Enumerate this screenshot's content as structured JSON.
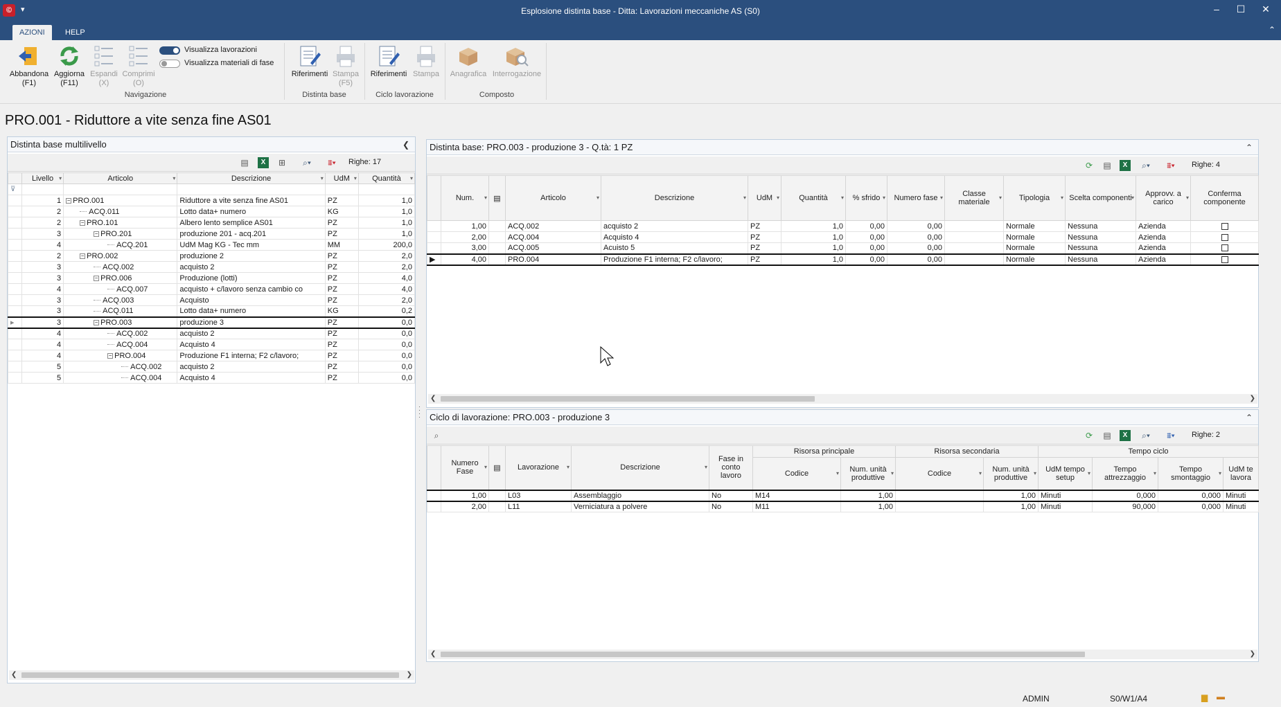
{
  "window": {
    "title": "Esplosione distinta base - Ditta: Lavorazioni meccaniche AS (S0)"
  },
  "tabs": [
    "AZIONI",
    "HELP"
  ],
  "ribbon": {
    "abbandona": "Abbandona",
    "abbandona_key": "(F1)",
    "aggiorna": "Aggiorna",
    "aggiorna_key": "(F11)",
    "espandi": "Espandi",
    "espandi_key": "(X)",
    "comprimi": "Comprimi",
    "comprimi_key": "(O)",
    "toggle_lavorazioni": "Visualizza lavorazioni",
    "toggle_materiali": "Visualizza materiali di fase",
    "group_navigazione": "Navigazione",
    "riferimenti1": "Riferimenti",
    "stampa1": "Stampa",
    "stampa1_key": "(F5)",
    "group_distinta": "Distinta base",
    "riferimenti2": "Riferimenti",
    "stampa2": "Stampa",
    "group_ciclo": "Ciclo lavorazione",
    "anagrafica": "Anagrafica",
    "interrogazione": "Interrogazione",
    "group_composto": "Composto"
  },
  "page_title": "PRO.001 - Riduttore a vite senza fine AS01",
  "left_panel": {
    "title": "Distinta base multilivello",
    "rowcount": "Righe: 17",
    "headers": [
      "Livello",
      "Articolo",
      "Descrizione",
      "UdM",
      "Quantità"
    ],
    "rows": [
      {
        "livello": "1",
        "articolo": "PRO.001",
        "desc": "Riduttore a vite senza fine AS01",
        "udm": "PZ",
        "qta": "1,0",
        "indent": 0,
        "kind": "node"
      },
      {
        "livello": "2",
        "articolo": "ACQ.011",
        "desc": "Lotto data+ numero",
        "udm": "KG",
        "qta": "1,0",
        "indent": 1,
        "kind": "leaf"
      },
      {
        "livello": "2",
        "articolo": "PRO.101",
        "desc": "Albero lento semplice AS01",
        "udm": "PZ",
        "qta": "1,0",
        "indent": 1,
        "kind": "node"
      },
      {
        "livello": "3",
        "articolo": "PRO.201",
        "desc": "produzione 201 - acq.201",
        "udm": "PZ",
        "qta": "1,0",
        "indent": 2,
        "kind": "node"
      },
      {
        "livello": "4",
        "articolo": "ACQ.201",
        "desc": "UdM Mag KG - Tec mm",
        "udm": "MM",
        "qta": "200,0",
        "indent": 3,
        "kind": "leaf"
      },
      {
        "livello": "2",
        "articolo": "PRO.002",
        "desc": "produzione 2",
        "udm": "PZ",
        "qta": "2,0",
        "indent": 1,
        "kind": "node"
      },
      {
        "livello": "3",
        "articolo": "ACQ.002",
        "desc": "acquisto 2",
        "udm": "PZ",
        "qta": "2,0",
        "indent": 2,
        "kind": "leaf"
      },
      {
        "livello": "3",
        "articolo": "PRO.006",
        "desc": "Produzione (lotti)",
        "udm": "PZ",
        "qta": "4,0",
        "indent": 2,
        "kind": "node"
      },
      {
        "livello": "4",
        "articolo": "ACQ.007",
        "desc": "acquisto + c/lavoro senza cambio co",
        "udm": "PZ",
        "qta": "4,0",
        "indent": 3,
        "kind": "leaf"
      },
      {
        "livello": "3",
        "articolo": "ACQ.003",
        "desc": "Acquisto",
        "udm": "PZ",
        "qta": "2,0",
        "indent": 2,
        "kind": "leaf"
      },
      {
        "livello": "3",
        "articolo": "ACQ.011",
        "desc": "Lotto data+ numero",
        "udm": "KG",
        "qta": "0,2",
        "indent": 2,
        "kind": "leaf"
      },
      {
        "livello": "3",
        "articolo": "PRO.003",
        "desc": "produzione 3",
        "udm": "PZ",
        "qta": "0,0",
        "indent": 2,
        "kind": "node",
        "selected": true
      },
      {
        "livello": "4",
        "articolo": "ACQ.002",
        "desc": "acquisto 2",
        "udm": "PZ",
        "qta": "0,0",
        "indent": 3,
        "kind": "leaf"
      },
      {
        "livello": "4",
        "articolo": "ACQ.004",
        "desc": "Acquisto 4",
        "udm": "PZ",
        "qta": "0,0",
        "indent": 3,
        "kind": "leaf"
      },
      {
        "livello": "4",
        "articolo": "PRO.004",
        "desc": "Produzione F1 interna; F2 c/lavoro;",
        "udm": "PZ",
        "qta": "0,0",
        "indent": 3,
        "kind": "node"
      },
      {
        "livello": "5",
        "articolo": "ACQ.002",
        "desc": "acquisto 2",
        "udm": "PZ",
        "qta": "0,0",
        "indent": 4,
        "kind": "leaf"
      },
      {
        "livello": "5",
        "articolo": "ACQ.004",
        "desc": "Acquisto 4",
        "udm": "PZ",
        "qta": "0,0",
        "indent": 4,
        "kind": "leaf"
      }
    ]
  },
  "top_right": {
    "title": "Distinta base: PRO.003 - produzione 3 - Q.tà: 1 PZ",
    "rowcount": "Righe: 4",
    "headers": [
      "Num.",
      "Articolo",
      "Descrizione",
      "UdM",
      "Quantità",
      "% sfrido",
      "Numero fase",
      "Classe materiale",
      "Tipologia",
      "Scelta componenti",
      "Approvv. a carico",
      "Conferma componente"
    ],
    "rows": [
      {
        "num": "1,00",
        "art": "ACQ.002",
        "desc": "acquisto 2",
        "udm": "PZ",
        "qta": "1,0",
        "sfrido": "0,00",
        "fase": "0,00",
        "classe": "",
        "tipo": "Normale",
        "scelta": "Nessuna",
        "approvv": "Azienda"
      },
      {
        "num": "2,00",
        "art": "ACQ.004",
        "desc": "Acquisto 4",
        "udm": "PZ",
        "qta": "1,0",
        "sfrido": "0,00",
        "fase": "0,00",
        "classe": "",
        "tipo": "Normale",
        "scelta": "Nessuna",
        "approvv": "Azienda"
      },
      {
        "num": "3,00",
        "art": "ACQ.005",
        "desc": "Acuisto 5",
        "udm": "PZ",
        "qta": "1,0",
        "sfrido": "0,00",
        "fase": "0,00",
        "classe": "",
        "tipo": "Normale",
        "scelta": "Nessuna",
        "approvv": "Azienda"
      },
      {
        "num": "4,00",
        "art": "PRO.004",
        "desc": "Produzione F1 interna; F2 c/lavoro;",
        "udm": "PZ",
        "qta": "1,0",
        "sfrido": "0,00",
        "fase": "0,00",
        "classe": "",
        "tipo": "Normale",
        "scelta": "Nessuna",
        "approvv": "Azienda",
        "selected": true
      }
    ]
  },
  "bottom_right": {
    "title": "Ciclo di lavorazione: PRO.003 - produzione 3",
    "rowcount": "Righe: 2",
    "group_headers": [
      "Risorsa principale",
      "Risorsa secondaria",
      "Tempo ciclo"
    ],
    "headers": [
      "Numero Fase",
      "Lavorazione",
      "Descrizione",
      "Fase in conto lavoro",
      "Codice",
      "Num. unità produttive",
      "Codice",
      "Num. unità produttive",
      "UdM tempo setup",
      "Tempo attrezzaggio",
      "Tempo smontaggio",
      "UdM te lavora"
    ],
    "rows": [
      {
        "fase": "1,00",
        "lav": "L03",
        "desc": "Assemblaggio",
        "conto": "No",
        "cod1": "M14",
        "num1": "1,00",
        "cod2": "",
        "num2": "1,00",
        "udm": "Minuti",
        "attr": "0,000",
        "smont": "0,000",
        "udm2": "Minuti",
        "selected": true
      },
      {
        "fase": "2,00",
        "lav": "L11",
        "desc": "Verniciatura a polvere",
        "conto": "No",
        "cod1": "M11",
        "num1": "1,00",
        "cod2": "",
        "num2": "1,00",
        "udm": "Minuti",
        "attr": "90,000",
        "smont": "0,000",
        "udm2": "Minuti"
      }
    ]
  },
  "status": {
    "user": "ADMIN",
    "env": "S0/W1/A4"
  },
  "colors": {
    "title_bar": "#2b4f7e",
    "accent_green": "#3a9a4a",
    "excel_green": "#1e7145"
  }
}
